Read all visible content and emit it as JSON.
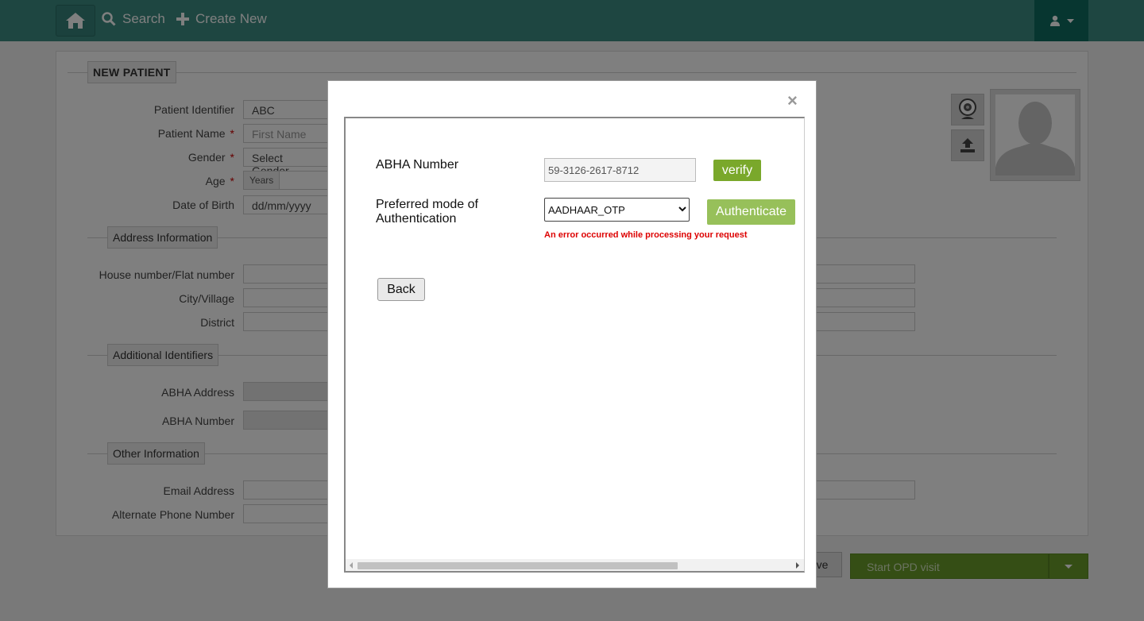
{
  "nav": {
    "search_label": "Search",
    "create_new_label": "Create New"
  },
  "form": {
    "section_new_patient": "NEW PATIENT",
    "patient_identifier_label": "Patient Identifier",
    "patient_identifier_value": "ABC",
    "patient_name_label": "Patient Name",
    "first_name_placeholder": "First Name",
    "gender_label": "Gender",
    "gender_value": "Select Gender",
    "age_label": "Age",
    "age_unit": "Years",
    "dob_label": "Date of Birth",
    "dob_placeholder": "dd/mm/yyyy",
    "required_mark": "*",
    "section_address": "Address Information",
    "house_label": "House number/Flat number",
    "city_label": "City/Village",
    "district_label": "District",
    "section_additional": "Additional Identifiers",
    "abha_address_label": "ABHA Address",
    "abha_number_label": "ABHA Number",
    "section_other": "Other Information",
    "email_label": "Email Address",
    "alt_phone_label": "Alternate Phone Number"
  },
  "bottom": {
    "save_label": "ve",
    "opd_label": "Start OPD visit"
  },
  "modal": {
    "close": "×",
    "abha_number_label": "ABHA Number",
    "abha_number_value": "59-3126-2617-8712",
    "verify_label": "verify",
    "auth_mode_label_1": "Preferred mode of",
    "auth_mode_label_2": "Authentication",
    "auth_mode_value": "AADHAAR_OTP",
    "authenticate_label": "Authenticate",
    "error_text": "An error occurred while processing your request",
    "back_label": "Back"
  },
  "colors": {
    "topbar": "#3d8c82",
    "user_menu": "#0f6c61",
    "primary_green": "#7aa82b",
    "error_red": "#dd0000"
  }
}
